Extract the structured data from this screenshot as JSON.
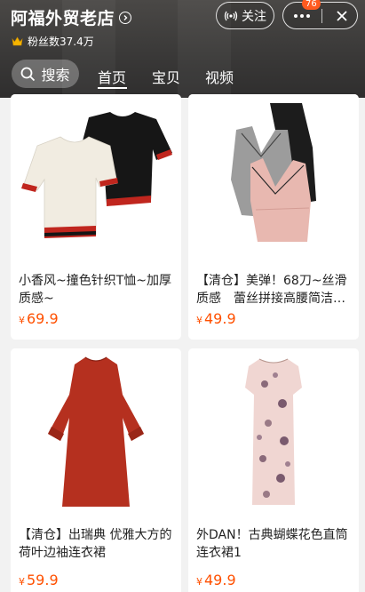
{
  "shop": {
    "name": "阿福外贸老店",
    "fans": "粉丝数37.4万"
  },
  "header_actions": {
    "follow_label": "关注",
    "notification_count": "76"
  },
  "search": {
    "label": "搜索"
  },
  "tabs": [
    {
      "label": "首页",
      "active": true
    },
    {
      "label": "宝贝",
      "active": false
    },
    {
      "label": "视频",
      "active": false
    }
  ],
  "products": [
    {
      "title": "小香风~撞色针织T恤~加厚质感~",
      "currency": "¥",
      "price": "69.9"
    },
    {
      "title": "【清仓】美弹！68刀~丝滑质感　蕾丝拼接高腰简洁…",
      "currency": "¥",
      "price": "49.9"
    },
    {
      "title": "【清仓】出瑞典 优雅大方的荷叶边袖连衣裙",
      "currency": "¥",
      "price": "59.9"
    },
    {
      "title": "外DAN！古典蝴蝶花色直筒连衣裙1",
      "currency": "¥",
      "price": "49.9"
    }
  ],
  "colors": {
    "price": "#ff5000",
    "badge": "#ff5a1f",
    "header_bg": "#3a3938"
  }
}
